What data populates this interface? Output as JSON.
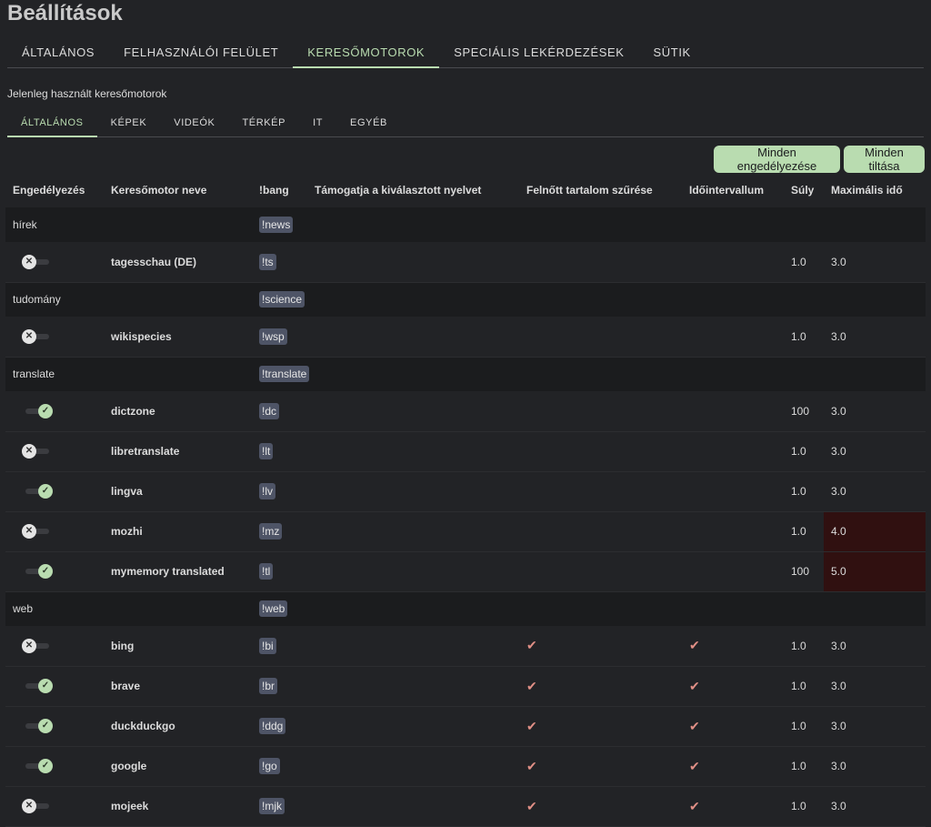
{
  "page_title": "Beállítások",
  "main_tabs": [
    {
      "label": "ÁLTALÁNOS",
      "active": false
    },
    {
      "label": "FELHASZNÁLÓI FELÜLET",
      "active": false
    },
    {
      "label": "KERESŐMOTOROK",
      "active": true
    },
    {
      "label": "SPECIÁLIS LEKÉRDEZÉSEK",
      "active": false
    },
    {
      "label": "SÜTIK",
      "active": false
    }
  ],
  "section_label": "Jelenleg használt keresőmotorok",
  "sub_tabs": [
    {
      "label": "ÁLTALÁNOS",
      "active": true
    },
    {
      "label": "KÉPEK",
      "active": false
    },
    {
      "label": "VIDEÓK",
      "active": false
    },
    {
      "label": "TÉRKÉP",
      "active": false
    },
    {
      "label": "IT",
      "active": false
    },
    {
      "label": "EGYÉB",
      "active": false
    }
  ],
  "buttons": {
    "enable_all": "Minden engedélyezése",
    "disable_all": "Minden tiltása"
  },
  "table": {
    "headers": [
      "Engedélyezés",
      "Keresőmotor neve",
      "!bang",
      "Támogatja a kiválasztott nyelvet",
      "Felnőtt tartalom szűrése",
      "Időintervallum",
      "Súly",
      "Maximális idő"
    ],
    "toggle_icons": {
      "on": "✓",
      "off": "✕"
    },
    "check_icon": "✔",
    "colors": {
      "accent": "#b9dcb0",
      "bang_bg": "#4e5466",
      "check": "#e08f86",
      "timeout_warning": "#301010"
    },
    "groups": [
      {
        "category": "hírek",
        "bang": "!news",
        "engines": [
          {
            "name": "tagesschau (DE)",
            "bang": "!ts",
            "enabled": false,
            "safesearch": false,
            "time_range": false,
            "weight": "1.0",
            "timeout": "3.0",
            "timeout_warning": false
          }
        ]
      },
      {
        "category": "tudomány",
        "bang": "!science",
        "engines": [
          {
            "name": "wikispecies",
            "bang": "!wsp",
            "enabled": false,
            "safesearch": false,
            "time_range": false,
            "weight": "1.0",
            "timeout": "3.0",
            "timeout_warning": false
          }
        ]
      },
      {
        "category": "translate",
        "bang": "!translate",
        "engines": [
          {
            "name": "dictzone",
            "bang": "!dc",
            "enabled": true,
            "safesearch": false,
            "time_range": false,
            "weight": "100",
            "timeout": "3.0",
            "timeout_warning": false
          },
          {
            "name": "libretranslate",
            "bang": "!lt",
            "enabled": false,
            "safesearch": false,
            "time_range": false,
            "weight": "1.0",
            "timeout": "3.0",
            "timeout_warning": false
          },
          {
            "name": "lingva",
            "bang": "!lv",
            "enabled": true,
            "safesearch": false,
            "time_range": false,
            "weight": "1.0",
            "timeout": "3.0",
            "timeout_warning": false
          },
          {
            "name": "mozhi",
            "bang": "!mz",
            "enabled": false,
            "safesearch": false,
            "time_range": false,
            "weight": "1.0",
            "timeout": "4.0",
            "timeout_warning": true
          },
          {
            "name": "mymemory translated",
            "bang": "!tl",
            "enabled": true,
            "safesearch": false,
            "time_range": false,
            "weight": "100",
            "timeout": "5.0",
            "timeout_warning": true
          }
        ]
      },
      {
        "category": "web",
        "bang": "!web",
        "engines": [
          {
            "name": "bing",
            "bang": "!bi",
            "enabled": false,
            "safesearch": true,
            "time_range": true,
            "weight": "1.0",
            "timeout": "3.0",
            "timeout_warning": false
          },
          {
            "name": "brave",
            "bang": "!br",
            "enabled": true,
            "safesearch": true,
            "time_range": true,
            "weight": "1.0",
            "timeout": "3.0",
            "timeout_warning": false
          },
          {
            "name": "duckduckgo",
            "bang": "!ddg",
            "enabled": true,
            "safesearch": true,
            "time_range": true,
            "weight": "1.0",
            "timeout": "3.0",
            "timeout_warning": false
          },
          {
            "name": "google",
            "bang": "!go",
            "enabled": true,
            "safesearch": true,
            "time_range": true,
            "weight": "1.0",
            "timeout": "3.0",
            "timeout_warning": false
          },
          {
            "name": "mojeek",
            "bang": "!mjk",
            "enabled": false,
            "safesearch": true,
            "time_range": true,
            "weight": "1.0",
            "timeout": "3.0",
            "timeout_warning": false
          }
        ]
      }
    ]
  }
}
